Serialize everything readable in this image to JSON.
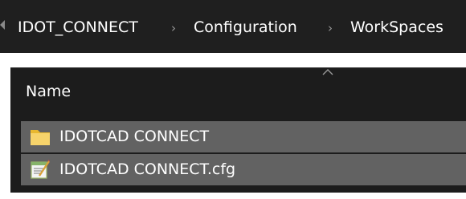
{
  "breadcrumb": {
    "items": [
      "IDOT_CONNECT",
      "Configuration",
      "WorkSpaces"
    ],
    "separator": "›"
  },
  "file_list": {
    "column_header": "Name",
    "sort_indicator": "chevron-up-icon",
    "rows": [
      {
        "name": "IDOTCAD CONNECT",
        "icon": "folder-icon",
        "selected": true
      },
      {
        "name": "IDOTCAD CONNECT.cfg",
        "icon": "config-file-icon",
        "selected": true
      }
    ]
  },
  "colors": {
    "breadcrumb_bg": "#1f1f1f",
    "pane_bg": "#1c1c1c",
    "selected_row_bg": "#626262",
    "text": "#ffffff",
    "folder_yellow": "#f6d36b"
  }
}
